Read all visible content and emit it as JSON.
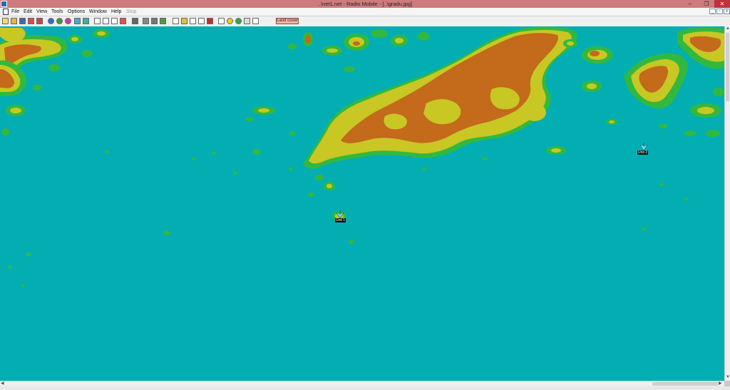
{
  "window": {
    "title": "..\\net1.net - Radio Mobile - [..\\gradu.jpg]",
    "minimize_glyph": "–",
    "restore_glyph": "❐",
    "close_glyph": "✕"
  },
  "menu": {
    "items": [
      "File",
      "Edit",
      "View",
      "Tools",
      "Options",
      "Window",
      "Help",
      "Stop"
    ],
    "mdi_minimize": "_",
    "mdi_restore": "▫",
    "mdi_close": "x"
  },
  "toolbar": {
    "icons": [
      "new-net-icon",
      "open-icon",
      "save-icon",
      "properties-icon",
      "wizard-icon",
      "globe-icon",
      "world-icon",
      "map-properties-icon",
      "back-arrow-icon",
      "forward-icon",
      "pane-icon",
      "copy-icon",
      "paste-icon",
      "print-icon",
      "network-icon",
      "picture-icon",
      "merge-icon",
      "radio-link-icon",
      "elevation-icon",
      "zoom-icon",
      "fit-icon",
      "center-icon",
      "close-map-icon",
      "text-icon",
      "target-icon",
      "coverage-icon",
      "fresnel-icon",
      "antenna-icon"
    ],
    "land_cover_label": "Land cover"
  },
  "map": {
    "colors": {
      "sea": "#03aeb2",
      "low": "#32b93d",
      "mid": "#c8c724",
      "high": "#c36a1b"
    },
    "units": [
      {
        "label": "Unit 1"
      },
      {
        "label": "Unit 2"
      }
    ]
  }
}
